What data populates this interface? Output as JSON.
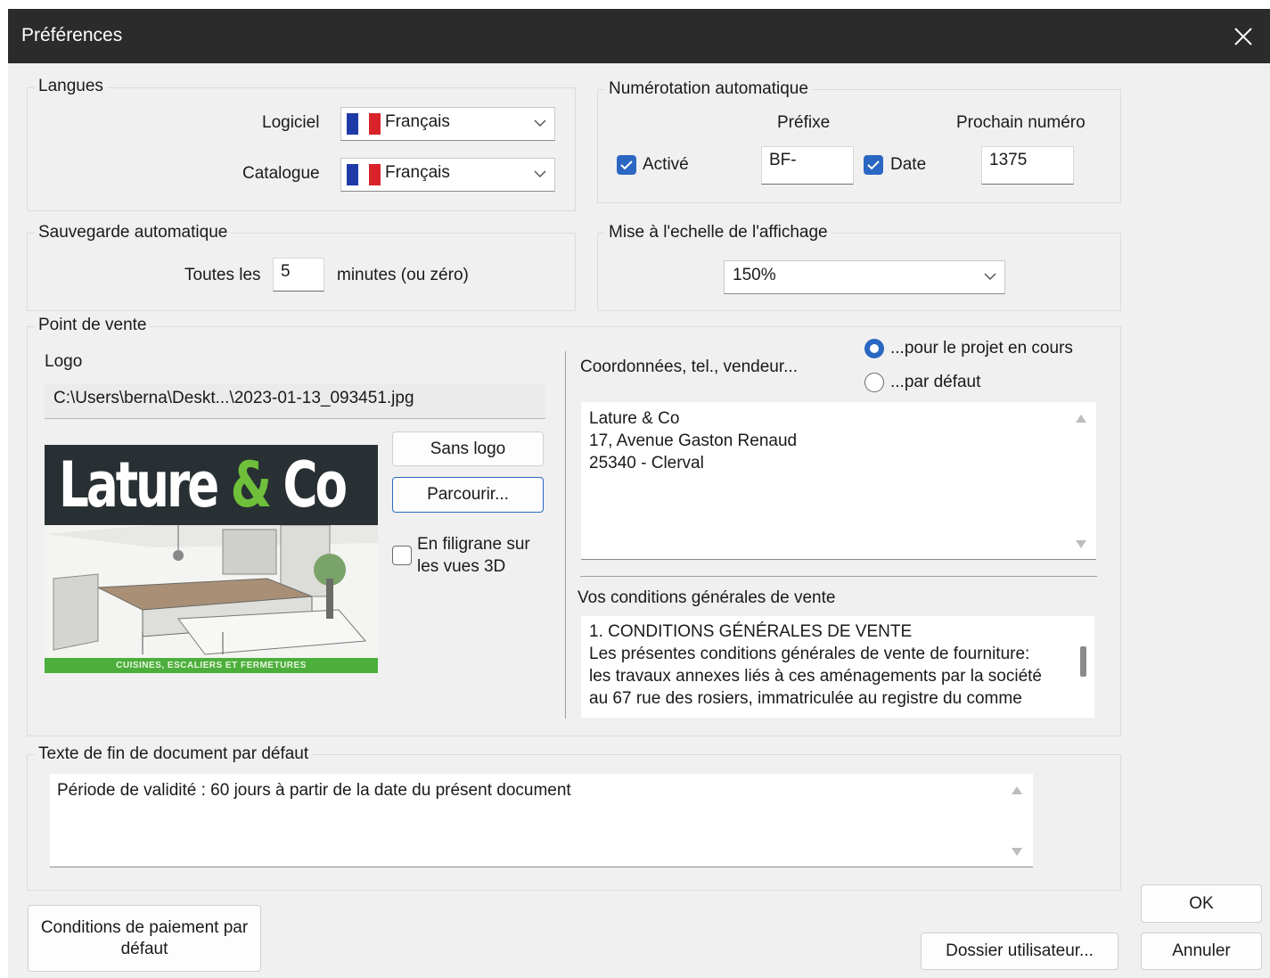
{
  "window": {
    "title": "Préférences"
  },
  "langues": {
    "legend": "Langues",
    "logiciel_label": "Logiciel",
    "logiciel_value": "Français",
    "catalogue_label": "Catalogue",
    "catalogue_value": "Français",
    "flag_colors": [
      "#1e3aa8",
      "#ffffff",
      "#d8232a"
    ]
  },
  "numerotation": {
    "legend": "Numérotation automatique",
    "prefixe_header": "Préfixe",
    "prochain_header": "Prochain numéro",
    "active_label": "Activé",
    "active_checked": true,
    "prefixe_value": "BF-",
    "date_label": "Date",
    "date_checked": true,
    "prochain_value": "1375"
  },
  "sauvegarde": {
    "legend": "Sauvegarde automatique",
    "toutes_label": "Toutes les",
    "minutes_value": "5",
    "minutes_label": "minutes (ou zéro)"
  },
  "echelle": {
    "legend": "Mise à l'echelle de l'affichage",
    "value": "150%"
  },
  "point_de_vente": {
    "legend": "Point de vente",
    "logo_label": "Logo",
    "logo_path": "C:\\Users\\berna\\Deskt...\\2023-01-13_093451.jpg",
    "logo_brand_1": "Lature ",
    "logo_brand_amp": "&",
    "logo_brand_2": " Co",
    "logo_tagline": "CUISINES, ESCALIERS ET FERMETURES",
    "sans_logo": "Sans logo",
    "parcourir": "Parcourir...",
    "filigrane_line1": "En filigrane sur",
    "filigrane_line2": "les vues 3D",
    "filigrane_checked": false,
    "coord_label": "Coordonnées, tel., vendeur...",
    "radio_projet": "...pour le projet en cours",
    "radio_defaut": "...par défaut",
    "selected_radio": "projet",
    "coord_lines": [
      "Lature & Co",
      "17, Avenue Gaston Renaud",
      "25340 - Clerval"
    ],
    "cgv_label": "Vos conditions générales de vente",
    "cgv_lines": [
      "1. CONDITIONS GÉNÉRALES DE VENTE",
      "Les présentes conditions générales de vente de fourniture:",
      "les travaux annexes liés à ces aménagements par la société",
      "au 67 rue des rosiers, immatriculée au registre du comme"
    ]
  },
  "fin_document": {
    "legend": "Texte de fin de document par défaut",
    "text": "Période de validité : 60 jours à partir de la date du présent document"
  },
  "buttons": {
    "conditions_line1": "Conditions de paiement par",
    "conditions_line2": "défaut",
    "dossier": "Dossier utilisateur...",
    "ok": "OK",
    "annuler": "Annuler"
  },
  "colors": {
    "accent": "#2a67c3",
    "titlebar": "#2b2b2b",
    "dialog_bg": "#f0f0f0"
  }
}
